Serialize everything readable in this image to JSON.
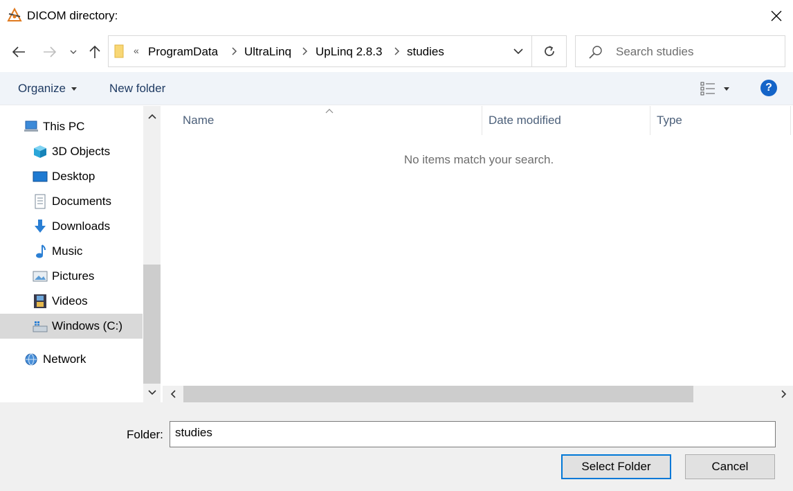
{
  "window": {
    "title": "DICOM directory:"
  },
  "address": {
    "overflow": "«",
    "crumbs": [
      "ProgramData",
      "UltraLinq",
      "UpLinq 2.8.3",
      "studies"
    ]
  },
  "search": {
    "placeholder": "Search studies",
    "value": ""
  },
  "toolbar": {
    "organize_label": "Organize",
    "new_folder_label": "New folder",
    "help_label": "?"
  },
  "navpane": {
    "items": [
      {
        "label": "This PC",
        "icon": "computer-icon"
      },
      {
        "label": "3D Objects",
        "icon": "cube-icon"
      },
      {
        "label": "Desktop",
        "icon": "desktop-icon"
      },
      {
        "label": "Documents",
        "icon": "document-icon"
      },
      {
        "label": "Downloads",
        "icon": "download-icon"
      },
      {
        "label": "Music",
        "icon": "music-note-icon"
      },
      {
        "label": "Pictures",
        "icon": "picture-icon"
      },
      {
        "label": "Videos",
        "icon": "film-icon"
      },
      {
        "label": "Windows (C:)",
        "icon": "drive-icon",
        "selected": true
      },
      {
        "label": "Network",
        "icon": "network-icon"
      }
    ]
  },
  "filelist": {
    "columns": [
      "Name",
      "Date modified",
      "Type"
    ],
    "sorted_by": "Name",
    "empty_message": "No items match your search."
  },
  "footer": {
    "folder_label": "Folder:",
    "folder_value": "studies",
    "select_label": "Select Folder",
    "cancel_label": "Cancel"
  },
  "colors": {
    "accent": "#0078d7",
    "help": "#1464c8",
    "toolbar_bg": "#f0f4f9",
    "footer_bg": "#f0f0f0",
    "selected_bg": "#d9d9d9"
  }
}
